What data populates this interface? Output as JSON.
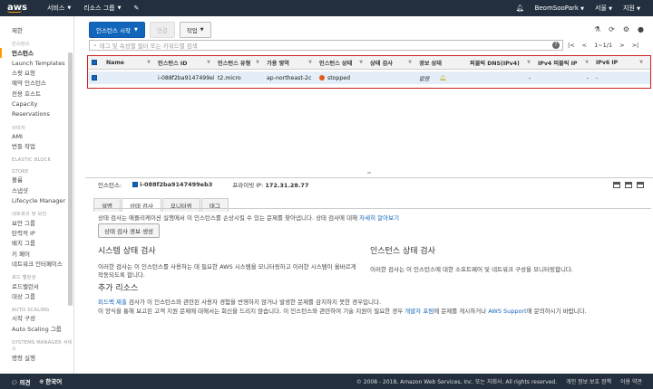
{
  "topnav": {
    "logo": "aws",
    "services": "서비스",
    "resource_groups": "리소스 그룹",
    "user": "BeomSooPark",
    "region": "서울",
    "support": "지원"
  },
  "sidebar": {
    "items": [
      {
        "type": "item",
        "label": "제한"
      },
      {
        "type": "section",
        "label": "인스턴스"
      },
      {
        "type": "item",
        "label": "인스턴스",
        "active": true
      },
      {
        "type": "item",
        "label": "Launch Templates"
      },
      {
        "type": "item",
        "label": "스팟 요청"
      },
      {
        "type": "item",
        "label": "예약 인스턴스"
      },
      {
        "type": "item",
        "label": "전용 호스트"
      },
      {
        "type": "item",
        "label": "Capacity"
      },
      {
        "type": "item",
        "label": "Reservations"
      },
      {
        "type": "section",
        "label": "이미지"
      },
      {
        "type": "item",
        "label": "AMI"
      },
      {
        "type": "item",
        "label": "번들 작업"
      },
      {
        "type": "section",
        "label": "ELASTIC BLOCK"
      },
      {
        "type": "section",
        "label": "STORE"
      },
      {
        "type": "item",
        "label": "볼륨"
      },
      {
        "type": "item",
        "label": "스냅샷"
      },
      {
        "type": "item",
        "label": "Lifecycle Manager"
      },
      {
        "type": "section",
        "label": "네트워크 및 보안"
      },
      {
        "type": "item",
        "label": "보안 그룹"
      },
      {
        "type": "item",
        "label": "탄력적 IP"
      },
      {
        "type": "item",
        "label": "배치 그룹"
      },
      {
        "type": "item",
        "label": "키 페어"
      },
      {
        "type": "item",
        "label": "네트워크 인터페이스"
      },
      {
        "type": "section",
        "label": "로드 밸런싱"
      },
      {
        "type": "item",
        "label": "로드밸런서"
      },
      {
        "type": "item",
        "label": "대상 그룹"
      },
      {
        "type": "section",
        "label": "AUTO SCALING"
      },
      {
        "type": "item",
        "label": "시작 구성"
      },
      {
        "type": "item",
        "label": "Auto Scaling 그룹"
      },
      {
        "type": "section",
        "label": "SYSTEMS MANAGER 서비스"
      },
      {
        "type": "item",
        "label": "명령 실행"
      }
    ]
  },
  "toolbar": {
    "launch": "인스턴스 시작",
    "connect": "연결",
    "actions": "작업"
  },
  "search": {
    "placeholder": "태그 및 속성별 필터 또는 키워드별 검색"
  },
  "pager": {
    "text": "1~1/1"
  },
  "table": {
    "columns": [
      "Name",
      "인스턴스 ID",
      "인스턴스 유형",
      "가용 영역",
      "인스턴스 상태",
      "상태 검사",
      "경보 상태",
      "퍼블릭 DNS(IPv4)",
      "IPv4 퍼블릭 IP",
      "IPv6 IP"
    ],
    "row": {
      "name": "",
      "instance_id": "i-088f2ba9147499eb3",
      "type": "t2.micro",
      "az": "ap-northeast-2c",
      "state": "stopped",
      "status_check": "",
      "alarm": "없음",
      "dns": "-",
      "ipv4": "-",
      "ipv6": "-"
    }
  },
  "details": {
    "instance_label": "인스턴스:",
    "instance_id": "i-088f2ba9147499eb3",
    "private_ip_label": "프라이빗 IP:",
    "private_ip": "172.31.28.77",
    "tabs": [
      "설명",
      "상태 검사",
      "모니터링",
      "태그"
    ],
    "active_tab": 1,
    "intro": "상태 검사는 애플리케이션 실행에서 이 인스턴스를 손상시킬 수 있는 문제를 찾아냅니다. 상태 검사에 대해",
    "intro_link": "자세히 알아보기",
    "gen_button": "상태 검사 경보 생성",
    "system_title": "시스템 상태 검사",
    "system_text_1": "이러한 검사는 이 인스턴스를 사용하는 데 필요한 AWS 시스템을 모니터링하고 이러한 시스템이 올바르게",
    "system_text_2": "작동되도록 합니다.",
    "instance_title": "인스턴스 상태 검사",
    "instance_text": "이러한 검사는 이 인스턴스에 대한 소프트웨어 및 네트워크 구성을 모니터링합니다.",
    "more_title": "추가 리소스",
    "more_link_1": "피드백 제출",
    "more_text_1": "검사가 이 인스턴스와 관련된 사용자 경험을 반영하지 않거나 발생한 문제를 감지하지 못한 경우입니다.",
    "more_text_2": "이 양식을 통해 보고된 고객 지원 문제에 대해서는 회신을 드리지 않습니다. 이 인스턴스와 관련하여 기술 지원이 필요한 경우",
    "more_link_2": "개발자 포럼",
    "more_text_3": "에 문제를 게시하거나",
    "more_link_3": "AWS Support",
    "more_text_4": "에 문의하시기 바랍니다."
  },
  "footer": {
    "feedback": "의견",
    "language": "한국어",
    "copyright": "© 2008 - 2018, Amazon Web Services, Inc. 또는 자회사. All rights reserved.",
    "privacy": "개인 정보 보호 정책",
    "terms": "이용 약관"
  }
}
